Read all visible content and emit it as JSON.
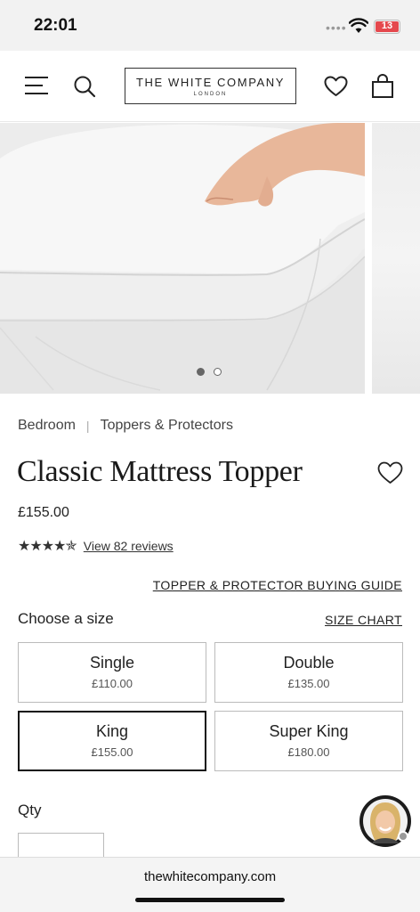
{
  "status_bar": {
    "time": "22:01",
    "battery": "13"
  },
  "header": {
    "logo_main": "THE WHITE COMPANY",
    "logo_sub": "LONDON"
  },
  "carousel": {
    "dot_count": 2,
    "active_index": 0
  },
  "breadcrumb": {
    "items": [
      "Bedroom",
      "Toppers & Protectors"
    ]
  },
  "product": {
    "title": "Classic Mattress Topper",
    "price": "£155.00",
    "rating": 4.5,
    "stars": "★★★★✯",
    "reviews_link": "View 82 reviews",
    "guide_link": "TOPPER & PROTECTOR BUYING GUIDE"
  },
  "size": {
    "heading": "Choose a size",
    "chart_link": "SIZE CHART",
    "options": [
      {
        "name": "Single",
        "price": "£110.00"
      },
      {
        "name": "Double",
        "price": "£135.00"
      },
      {
        "name": "King",
        "price": "£155.00"
      },
      {
        "name": "Super King",
        "price": "£180.00"
      }
    ],
    "selected": "King"
  },
  "quantity": {
    "label": "Qty"
  },
  "browser": {
    "url": "thewhitecompany.com"
  }
}
